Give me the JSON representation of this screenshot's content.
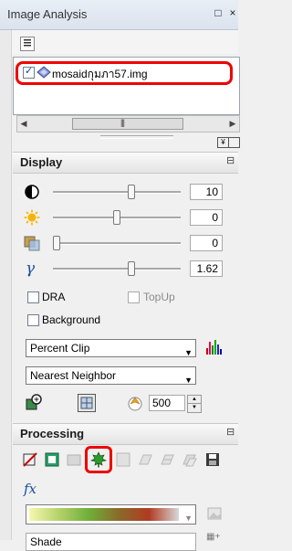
{
  "panel": {
    "title": "Image Analysis",
    "pin_glyph": "□",
    "close_glyph": "×"
  },
  "layers": [
    {
      "name": "mosaidกุมภา57.img",
      "checked": true,
      "selected": true
    }
  ],
  "scroll": {
    "grip": "|||"
  },
  "sections": {
    "display": {
      "label": "Display"
    },
    "processing": {
      "label": "Processing"
    }
  },
  "display": {
    "sliders": [
      {
        "icon": "contrast-icon",
        "value": "10",
        "level": 0.62
      },
      {
        "icon": "brightness-icon",
        "value": "0",
        "level": 0.5
      },
      {
        "icon": "transparency-icon",
        "value": "0",
        "level": 0.0
      },
      {
        "icon": "gamma-icon",
        "value": "1.62",
        "level": 0.62
      }
    ],
    "dra_label": "DRA",
    "topup_label": "TopUp",
    "background_label": "Background",
    "stretch_options_selected": "Percent Clip",
    "resampling_selected": "Nearest Neighbor",
    "scale_value": "500"
  },
  "processing": {
    "colormap_placeholder": "",
    "bottom_field": "Shade"
  },
  "colors": {
    "highlight_red": "#e00000",
    "accent_blue": "#1a3f8a"
  }
}
